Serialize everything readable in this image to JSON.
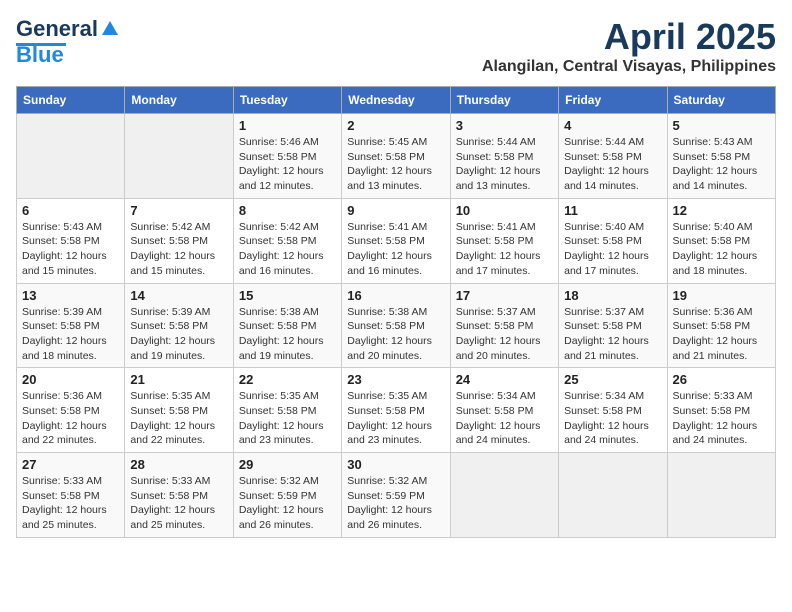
{
  "header": {
    "logo_line1": "General",
    "logo_line2": "Blue",
    "month_title": "April 2025",
    "location": "Alangilan, Central Visayas, Philippines"
  },
  "calendar": {
    "headers": [
      "Sunday",
      "Monday",
      "Tuesday",
      "Wednesday",
      "Thursday",
      "Friday",
      "Saturday"
    ],
    "weeks": [
      [
        {
          "day": "",
          "sunrise": "",
          "sunset": "",
          "daylight": ""
        },
        {
          "day": "",
          "sunrise": "",
          "sunset": "",
          "daylight": ""
        },
        {
          "day": "1",
          "sunrise": "Sunrise: 5:46 AM",
          "sunset": "Sunset: 5:58 PM",
          "daylight": "Daylight: 12 hours and 12 minutes."
        },
        {
          "day": "2",
          "sunrise": "Sunrise: 5:45 AM",
          "sunset": "Sunset: 5:58 PM",
          "daylight": "Daylight: 12 hours and 13 minutes."
        },
        {
          "day": "3",
          "sunrise": "Sunrise: 5:44 AM",
          "sunset": "Sunset: 5:58 PM",
          "daylight": "Daylight: 12 hours and 13 minutes."
        },
        {
          "day": "4",
          "sunrise": "Sunrise: 5:44 AM",
          "sunset": "Sunset: 5:58 PM",
          "daylight": "Daylight: 12 hours and 14 minutes."
        },
        {
          "day": "5",
          "sunrise": "Sunrise: 5:43 AM",
          "sunset": "Sunset: 5:58 PM",
          "daylight": "Daylight: 12 hours and 14 minutes."
        }
      ],
      [
        {
          "day": "6",
          "sunrise": "Sunrise: 5:43 AM",
          "sunset": "Sunset: 5:58 PM",
          "daylight": "Daylight: 12 hours and 15 minutes."
        },
        {
          "day": "7",
          "sunrise": "Sunrise: 5:42 AM",
          "sunset": "Sunset: 5:58 PM",
          "daylight": "Daylight: 12 hours and 15 minutes."
        },
        {
          "day": "8",
          "sunrise": "Sunrise: 5:42 AM",
          "sunset": "Sunset: 5:58 PM",
          "daylight": "Daylight: 12 hours and 16 minutes."
        },
        {
          "day": "9",
          "sunrise": "Sunrise: 5:41 AM",
          "sunset": "Sunset: 5:58 PM",
          "daylight": "Daylight: 12 hours and 16 minutes."
        },
        {
          "day": "10",
          "sunrise": "Sunrise: 5:41 AM",
          "sunset": "Sunset: 5:58 PM",
          "daylight": "Daylight: 12 hours and 17 minutes."
        },
        {
          "day": "11",
          "sunrise": "Sunrise: 5:40 AM",
          "sunset": "Sunset: 5:58 PM",
          "daylight": "Daylight: 12 hours and 17 minutes."
        },
        {
          "day": "12",
          "sunrise": "Sunrise: 5:40 AM",
          "sunset": "Sunset: 5:58 PM",
          "daylight": "Daylight: 12 hours and 18 minutes."
        }
      ],
      [
        {
          "day": "13",
          "sunrise": "Sunrise: 5:39 AM",
          "sunset": "Sunset: 5:58 PM",
          "daylight": "Daylight: 12 hours and 18 minutes."
        },
        {
          "day": "14",
          "sunrise": "Sunrise: 5:39 AM",
          "sunset": "Sunset: 5:58 PM",
          "daylight": "Daylight: 12 hours and 19 minutes."
        },
        {
          "day": "15",
          "sunrise": "Sunrise: 5:38 AM",
          "sunset": "Sunset: 5:58 PM",
          "daylight": "Daylight: 12 hours and 19 minutes."
        },
        {
          "day": "16",
          "sunrise": "Sunrise: 5:38 AM",
          "sunset": "Sunset: 5:58 PM",
          "daylight": "Daylight: 12 hours and 20 minutes."
        },
        {
          "day": "17",
          "sunrise": "Sunrise: 5:37 AM",
          "sunset": "Sunset: 5:58 PM",
          "daylight": "Daylight: 12 hours and 20 minutes."
        },
        {
          "day": "18",
          "sunrise": "Sunrise: 5:37 AM",
          "sunset": "Sunset: 5:58 PM",
          "daylight": "Daylight: 12 hours and 21 minutes."
        },
        {
          "day": "19",
          "sunrise": "Sunrise: 5:36 AM",
          "sunset": "Sunset: 5:58 PM",
          "daylight": "Daylight: 12 hours and 21 minutes."
        }
      ],
      [
        {
          "day": "20",
          "sunrise": "Sunrise: 5:36 AM",
          "sunset": "Sunset: 5:58 PM",
          "daylight": "Daylight: 12 hours and 22 minutes."
        },
        {
          "day": "21",
          "sunrise": "Sunrise: 5:35 AM",
          "sunset": "Sunset: 5:58 PM",
          "daylight": "Daylight: 12 hours and 22 minutes."
        },
        {
          "day": "22",
          "sunrise": "Sunrise: 5:35 AM",
          "sunset": "Sunset: 5:58 PM",
          "daylight": "Daylight: 12 hours and 23 minutes."
        },
        {
          "day": "23",
          "sunrise": "Sunrise: 5:35 AM",
          "sunset": "Sunset: 5:58 PM",
          "daylight": "Daylight: 12 hours and 23 minutes."
        },
        {
          "day": "24",
          "sunrise": "Sunrise: 5:34 AM",
          "sunset": "Sunset: 5:58 PM",
          "daylight": "Daylight: 12 hours and 24 minutes."
        },
        {
          "day": "25",
          "sunrise": "Sunrise: 5:34 AM",
          "sunset": "Sunset: 5:58 PM",
          "daylight": "Daylight: 12 hours and 24 minutes."
        },
        {
          "day": "26",
          "sunrise": "Sunrise: 5:33 AM",
          "sunset": "Sunset: 5:58 PM",
          "daylight": "Daylight: 12 hours and 24 minutes."
        }
      ],
      [
        {
          "day": "27",
          "sunrise": "Sunrise: 5:33 AM",
          "sunset": "Sunset: 5:58 PM",
          "daylight": "Daylight: 12 hours and 25 minutes."
        },
        {
          "day": "28",
          "sunrise": "Sunrise: 5:33 AM",
          "sunset": "Sunset: 5:58 PM",
          "daylight": "Daylight: 12 hours and 25 minutes."
        },
        {
          "day": "29",
          "sunrise": "Sunrise: 5:32 AM",
          "sunset": "Sunset: 5:59 PM",
          "daylight": "Daylight: 12 hours and 26 minutes."
        },
        {
          "day": "30",
          "sunrise": "Sunrise: 5:32 AM",
          "sunset": "Sunset: 5:59 PM",
          "daylight": "Daylight: 12 hours and 26 minutes."
        },
        {
          "day": "",
          "sunrise": "",
          "sunset": "",
          "daylight": ""
        },
        {
          "day": "",
          "sunrise": "",
          "sunset": "",
          "daylight": ""
        },
        {
          "day": "",
          "sunrise": "",
          "sunset": "",
          "daylight": ""
        }
      ]
    ]
  }
}
